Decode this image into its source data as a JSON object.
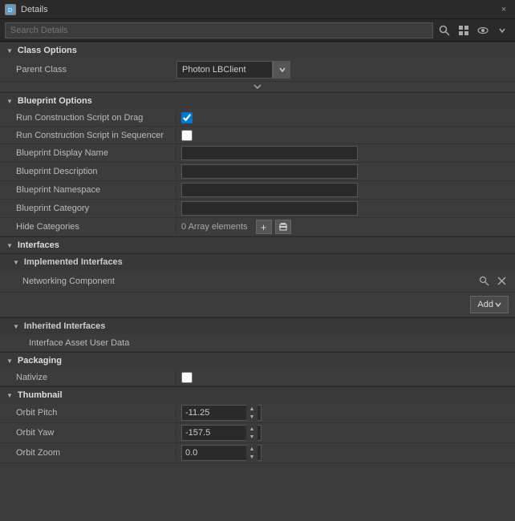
{
  "titleBar": {
    "title": "Details",
    "closeLabel": "×"
  },
  "search": {
    "placeholder": "Search Details",
    "searchIconUnicode": "🔍",
    "gridIconUnicode": "▦",
    "eyeIconUnicode": "👁"
  },
  "sections": {
    "classOptions": {
      "label": "Class Options",
      "parentClassLabel": "Parent Class",
      "parentClassValue": "Photon LBClient"
    },
    "blueprintOptions": {
      "label": "Blueprint Options",
      "runConstructionDrag": {
        "label": "Run Construction Script on Drag",
        "checked": true
      },
      "runConstructionSequencer": {
        "label": "Run Construction Script in Sequencer",
        "checked": false
      },
      "displayName": {
        "label": "Blueprint Display Name",
        "value": ""
      },
      "description": {
        "label": "Blueprint Description",
        "value": ""
      },
      "namespace": {
        "label": "Blueprint Namespace",
        "value": ""
      },
      "category": {
        "label": "Blueprint Category",
        "value": ""
      },
      "hideCategories": {
        "label": "Hide Categories",
        "arrayCount": "0 Array elements",
        "addLabel": "+",
        "removeLabel": "🗑"
      }
    },
    "interfaces": {
      "label": "Interfaces",
      "implemented": {
        "label": "Implemented Interfaces",
        "items": [
          {
            "name": "Networking Component"
          }
        ],
        "addLabel": "Add",
        "addArrow": "▼"
      },
      "inherited": {
        "label": "Inherited Interfaces",
        "items": [
          {
            "name": "Interface Asset User Data"
          }
        ]
      }
    },
    "packaging": {
      "label": "Packaging",
      "nativize": {
        "label": "Nativize",
        "checked": false
      }
    },
    "thumbnail": {
      "label": "Thumbnail",
      "orbitPitch": {
        "label": "Orbit Pitch",
        "value": "-11.25"
      },
      "orbitYaw": {
        "label": "Orbit Yaw",
        "value": "-157.5"
      },
      "orbitZoom": {
        "label": "Orbit Zoom",
        "value": "0.0"
      }
    }
  }
}
